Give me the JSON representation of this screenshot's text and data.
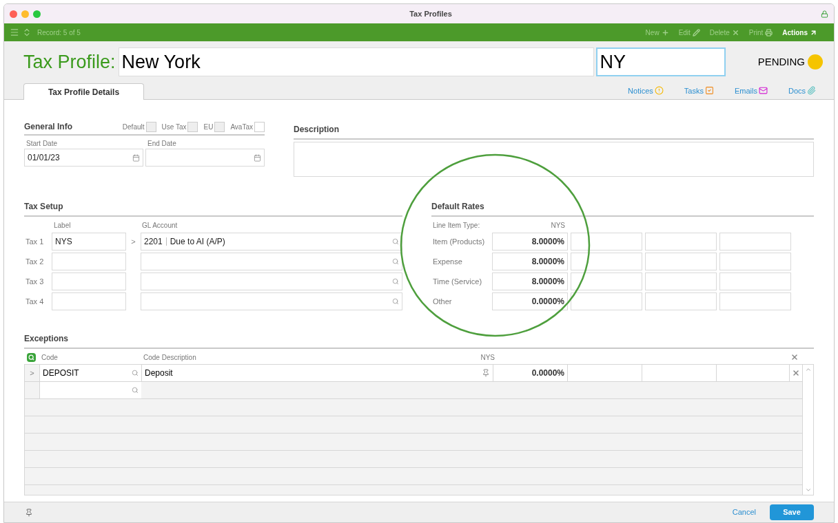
{
  "window": {
    "title": "Tax Profiles"
  },
  "toolbar": {
    "record": "Record: 5 of 5",
    "actions": [
      {
        "label": "New",
        "kind": "new",
        "disabled": true
      },
      {
        "label": "Edit",
        "kind": "edit",
        "disabled": true
      },
      {
        "label": "Delete",
        "kind": "delete",
        "disabled": true
      },
      {
        "label": "Print",
        "kind": "print",
        "disabled": true
      },
      {
        "label": "Actions",
        "kind": "actions",
        "disabled": false
      }
    ]
  },
  "header": {
    "label": "Tax Profile:",
    "name": "New York",
    "code": "NY",
    "status": {
      "label": "PENDING",
      "color": "#f5c400"
    }
  },
  "tabs": [
    {
      "label": "Tax Profile Details",
      "selected": true
    }
  ],
  "links": [
    {
      "label": "Notices",
      "kind": "notices"
    },
    {
      "label": "Tasks",
      "kind": "tasks"
    },
    {
      "label": "Emails",
      "kind": "emails"
    },
    {
      "label": "Docs",
      "kind": "docs"
    }
  ],
  "general_info": {
    "title": "General Info",
    "flags": [
      {
        "label": "Default",
        "checked": false,
        "disabled": true
      },
      {
        "label": "Use Tax",
        "checked": false,
        "disabled": true
      },
      {
        "label": "EU",
        "checked": false,
        "disabled": true
      },
      {
        "label": "AvaTax",
        "checked": false,
        "disabled": false
      }
    ],
    "start_date": {
      "label": "Start Date",
      "value": "01/01/23"
    },
    "end_date": {
      "label": "End Date"
    }
  },
  "description": {
    "title": "Description"
  },
  "tax_setup": {
    "title": "Tax Setup",
    "label_column": "Label",
    "account_column": "GL Account",
    "rows": [
      {
        "name": "Tax 1",
        "label": "NYS",
        "marker": ">",
        "account_number": "2201",
        "account_name": "Due to AI (A/P)"
      },
      {
        "name": "Tax 2"
      },
      {
        "name": "Tax 3"
      },
      {
        "name": "Tax 4"
      }
    ]
  },
  "default_rates": {
    "title": "Default Rates",
    "type_label": "Line Item Type:",
    "column": "NYS",
    "rows": [
      {
        "type": "Item (Products)",
        "rate": "8.0000%"
      },
      {
        "type": "Expense",
        "rate": "8.0000%"
      },
      {
        "type": "Time (Service)",
        "rate": "8.0000%"
      },
      {
        "type": "Other",
        "rate": "0.0000%"
      }
    ]
  },
  "exceptions": {
    "title": "Exceptions",
    "code_column": "Code",
    "description_column": "Code Description",
    "rate_column": "NYS",
    "rows": [
      {
        "marker": ">",
        "code": "DEPOSIT",
        "description": "Deposit",
        "rate": "0.0000%"
      }
    ]
  },
  "footer": {
    "cancel": "Cancel",
    "save": "Save"
  }
}
